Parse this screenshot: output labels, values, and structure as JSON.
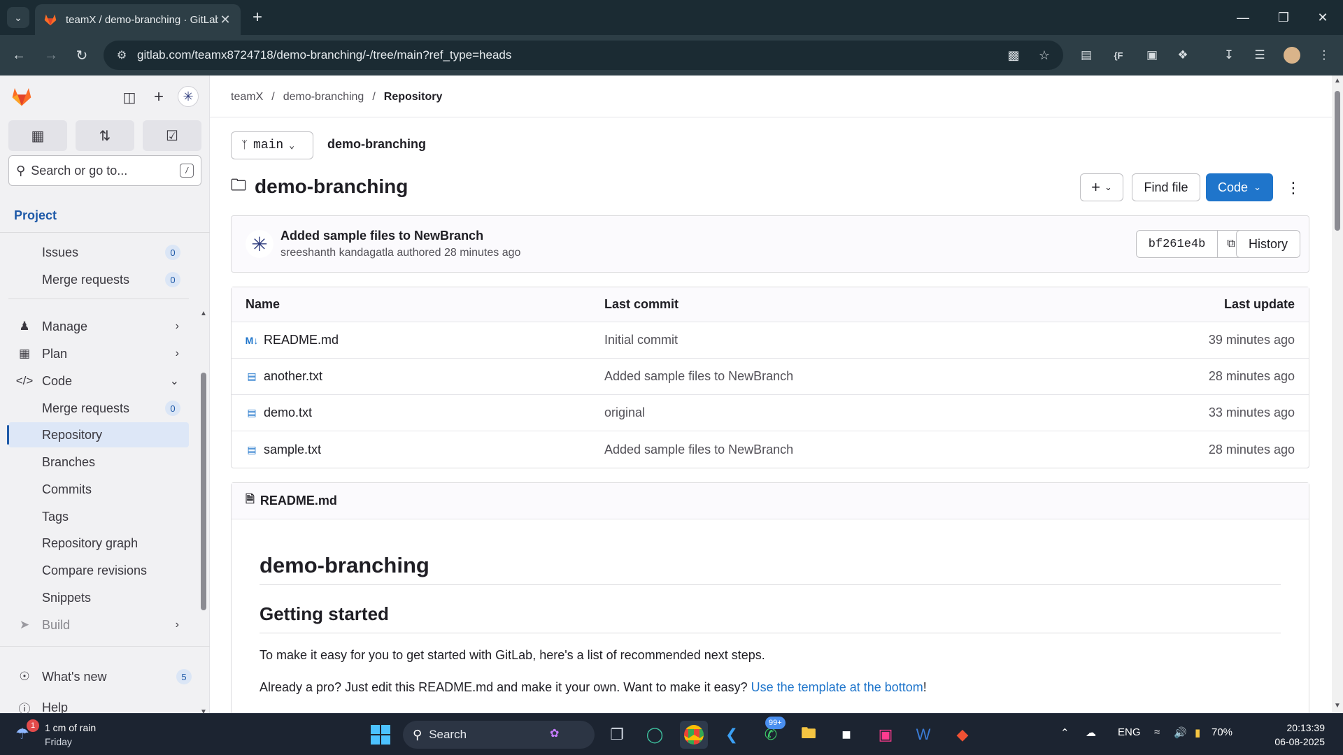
{
  "browser": {
    "tab_title": "teamX / demo-branching · GitLab",
    "url": "gitlab.com/teamx8724718/demo-branching/-/tree/main?ref_type=heads"
  },
  "sidebar": {
    "search_placeholder": "Search or go to...",
    "search_shortcut": "/",
    "section_title": "Project",
    "items": [
      {
        "label": "Issues",
        "badge": "0"
      },
      {
        "label": "Merge requests",
        "badge": "0"
      },
      {
        "label": "Manage"
      },
      {
        "label": "Plan"
      },
      {
        "label": "Code"
      },
      {
        "label": "Merge requests",
        "badge": "0"
      },
      {
        "label": "Repository"
      },
      {
        "label": "Branches"
      },
      {
        "label": "Commits"
      },
      {
        "label": "Tags"
      },
      {
        "label": "Repository graph"
      },
      {
        "label": "Compare revisions"
      },
      {
        "label": "Snippets"
      },
      {
        "label": "Build"
      }
    ],
    "whats_new_label": "What's new",
    "whats_new_badge": "5",
    "help_label": "Help"
  },
  "breadcrumbs": [
    "teamX",
    "demo-branching",
    "Repository"
  ],
  "branch": "main",
  "project_crumb": "demo-branching",
  "repo_title": "demo-branching",
  "actions": {
    "add_label": "+",
    "find_file": "Find file",
    "code": "Code"
  },
  "last_commit": {
    "message": "Added sample files to NewBranch",
    "author": "sreeshanth kandagatla",
    "authored": "authored",
    "time": "28 minutes ago",
    "sha": "bf261e4b",
    "history": "History"
  },
  "files": {
    "headers": [
      "Name",
      "Last commit",
      "Last update"
    ],
    "rows": [
      {
        "name": "README.md",
        "icon": "markdown-icon",
        "commit": "Initial commit",
        "updated": "39 minutes ago"
      },
      {
        "name": "another.txt",
        "icon": "file-icon",
        "commit": "Added sample files to NewBranch",
        "updated": "28 minutes ago"
      },
      {
        "name": "demo.txt",
        "icon": "file-icon",
        "commit": "original",
        "updated": "33 minutes ago"
      },
      {
        "name": "sample.txt",
        "icon": "file-icon",
        "commit": "Added sample files to NewBranch",
        "updated": "28 minutes ago"
      }
    ]
  },
  "readme": {
    "file": "README.md",
    "h1": "demo-branching",
    "h2": "Getting started",
    "p1": "To make it easy for you to get started with GitLab, here's a list of recommended next steps.",
    "p2_prefix": "Already a pro? Just edit this README.md and make it your own. Want to make it easy? ",
    "p2_link": "Use the template at the bottom",
    "p2_suffix": "!"
  },
  "taskbar": {
    "weather_badge": "1",
    "weather_line1": "1 cm of rain",
    "weather_line2": "Friday",
    "search_label": "Search",
    "whatsapp_badge": "99+",
    "language": "ENG",
    "battery": "70%",
    "time": "20:13:39",
    "date": "06-08-2025"
  },
  "colors": {
    "accent": "#1f75cb",
    "sidebar_bg": "#f1f1f3",
    "chrome_dark": "#1b2b33",
    "taskbar": "#1c2431"
  }
}
